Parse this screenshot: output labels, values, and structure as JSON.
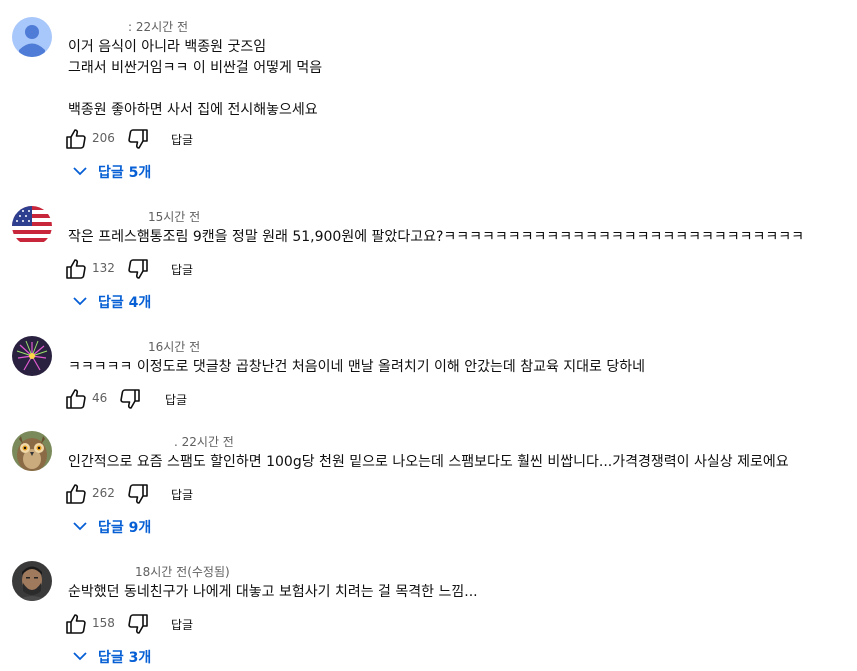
{
  "actions": {
    "reply_label": "답글"
  },
  "comments": [
    {
      "time": ": 22시간 전",
      "text": "이거 음식이 아니라 백종원 굿즈임\n그래서 비싼거임ㅋㅋ 이 비싼걸 어떻게 먹음\n\n백종원 좋아하면 사서 집에 전시해놓으세요",
      "likes": "206",
      "replies": "답글 5개",
      "avatar": "default-person-avatar"
    },
    {
      "time": "15시간 전",
      "text": "작은 프레스햄통조림 9캔을 정말 원래 51,900원에 팔았다고요?ㅋㅋㅋㅋㅋㅋㅋㅋㅋㅋㅋㅋㅋㅋㅋㅋㅋㅋㅋㅋㅋㅋㅋㅋㅋㅋㅋㅋ",
      "likes": "132",
      "replies": "답글 4개",
      "avatar": "us-flag-avatar"
    },
    {
      "time": "16시간 전",
      "text": "ㅋㅋㅋㅋㅋ 이정도로 댓글창 곱창난건 처음이네 맨날 올려치기 이해 안갔는데 참교육 지대로 당하네",
      "likes": "46",
      "replies": "",
      "avatar": "fireworks-avatar"
    },
    {
      "time": ". 22시간 전",
      "text": "인간적으로 요즘 스팸도 할인하면 100g당 천원 밑으로 나오는데 스팸보다도 훨씬 비쌉니다...가격경쟁력이 사실상 제로에요",
      "likes": "262",
      "replies": "답글 9개",
      "avatar": "owl-avatar"
    },
    {
      "time": "18시간 전(수정됨)",
      "text": "순박했던 동네친구가 나에게 대놓고 보험사기 치려는 걸 목격한 느낌...",
      "likes": "158",
      "replies": "답글 3개",
      "avatar": "man-portrait-avatar"
    }
  ],
  "colors": {
    "link": "#065fd4",
    "secondary_text": "#606060",
    "primary_text": "#0f0f0f"
  }
}
